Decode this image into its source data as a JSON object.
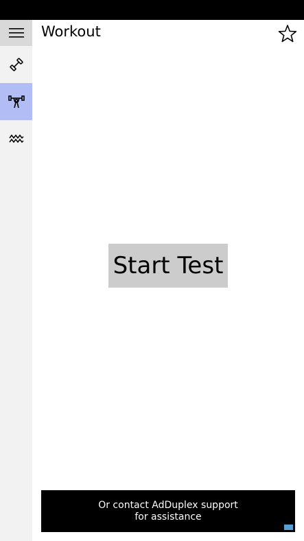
{
  "app": {
    "title": "Workout"
  },
  "sidebar": {
    "menu_icon": "hamburger-icon",
    "items": [
      {
        "icon": "dumbbell-icon",
        "active": false
      },
      {
        "icon": "weightlifter-icon",
        "active": true
      },
      {
        "icon": "wave-chart-icon",
        "active": false
      }
    ]
  },
  "header": {
    "favorite_icon": "star-outline-icon"
  },
  "main": {
    "start_button_label": "Start Test"
  },
  "ad": {
    "line1": "Or contact AdDuplex support",
    "line2": "for assistance"
  },
  "colors": {
    "accent_selected": "#b3bdf5",
    "sidebar_bg": "#f2f2f2",
    "button_bg": "#cccccc"
  }
}
